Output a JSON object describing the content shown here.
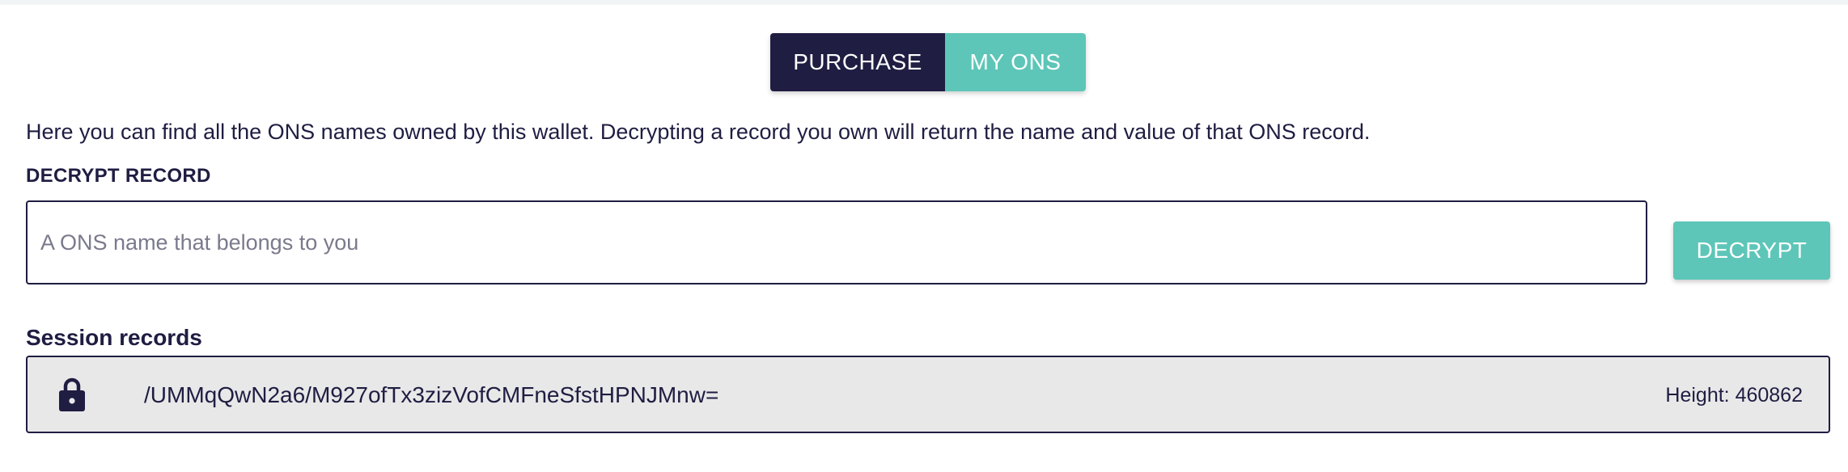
{
  "tabs": {
    "purchase": "PURCHASE",
    "my_ons": "MY ONS"
  },
  "intro_text": "Here you can find all the ONS names owned by this wallet. Decrypting a record you own will return the name and value of that ONS record.",
  "decrypt": {
    "label": "DECRYPT RECORD",
    "placeholder": "A ONS name that belongs to you",
    "value": "",
    "button_label": "DECRYPT"
  },
  "session_records": {
    "heading": "Session records",
    "items": [
      {
        "icon": "lock-icon",
        "name": "/UMMqQwN2a6/M927ofTx3zizVofCMFneSfstHPNJMnw=",
        "height": "Height: 460862"
      }
    ]
  },
  "colors": {
    "navy": "#1f1d42",
    "teal": "#5dc6b8",
    "record_bg": "#e8e8e8"
  }
}
